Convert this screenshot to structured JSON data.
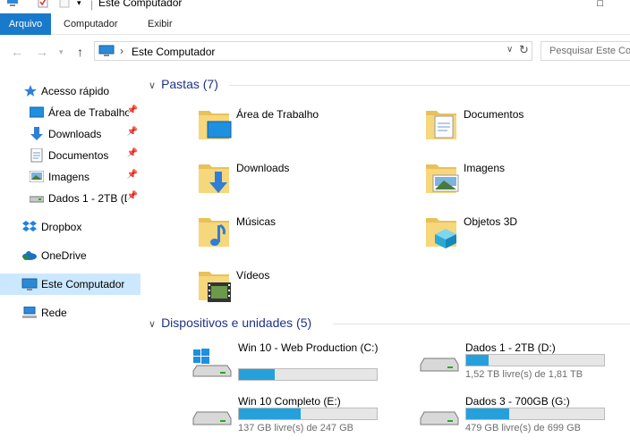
{
  "window": {
    "title": "Este Computador"
  },
  "ribbon": {
    "tabs": [
      "Arquivo",
      "Computador",
      "Exibir"
    ]
  },
  "address": {
    "path": "Este Computador",
    "search_placeholder": "Pesquisar Este Co"
  },
  "sidebar": {
    "items": [
      {
        "label": "Acesso rápido",
        "icon": "star-icon"
      },
      {
        "label": "Área de Trabalho",
        "icon": "desktop-icon",
        "pinned": true
      },
      {
        "label": "Downloads",
        "icon": "download-icon",
        "pinned": true
      },
      {
        "label": "Documentos",
        "icon": "documents-icon",
        "pinned": true
      },
      {
        "label": "Imagens",
        "icon": "pictures-icon",
        "pinned": true
      },
      {
        "label": "Dados 1 - 2TB (D:",
        "icon": "drive-icon",
        "pinned": true
      },
      {
        "label": "Dropbox",
        "icon": "dropbox-icon"
      },
      {
        "label": "OneDrive",
        "icon": "onedrive-icon"
      },
      {
        "label": "Este Computador",
        "icon": "computer-icon",
        "selected": true
      },
      {
        "label": "Rede",
        "icon": "network-icon"
      }
    ]
  },
  "folders_section": {
    "title": "Pastas (7)",
    "items": [
      {
        "label": "Área de Trabalho",
        "icon": "desktop-folder-icon"
      },
      {
        "label": "Documentos",
        "icon": "documents-folder-icon"
      },
      {
        "label": "Downloads",
        "icon": "downloads-folder-icon"
      },
      {
        "label": "Imagens",
        "icon": "pictures-folder-icon"
      },
      {
        "label": "Músicas",
        "icon": "music-folder-icon"
      },
      {
        "label": "Objetos 3D",
        "icon": "3d-objects-folder-icon"
      },
      {
        "label": "Vídeos",
        "icon": "videos-folder-icon"
      }
    ]
  },
  "drives_section": {
    "title": "Dispositivos e unidades (5)",
    "items": [
      {
        "label": "Win 10 - Web Production (C:)",
        "free": "",
        "used_fraction": 0.26,
        "icon": "windows-drive-icon"
      },
      {
        "label": "Dados 1 - 2TB (D:)",
        "free": "1,52 TB livre(s) de 1,81 TB",
        "used_fraction": 0.16,
        "icon": "drive-icon"
      },
      {
        "label": "Win 10 Completo (E:)",
        "free": "137 GB livre(s) de 247 GB",
        "used_fraction": 0.45,
        "icon": "drive-icon"
      },
      {
        "label": "Dados 3 - 700GB (G:)",
        "free": "479 GB livre(s) de 699 GB",
        "used_fraction": 0.31,
        "icon": "drive-icon"
      }
    ]
  },
  "colors": {
    "accent": "#1979ca",
    "selection": "#cce8ff",
    "section_title": "#1e3287",
    "bar_fill": "#26a0da"
  }
}
